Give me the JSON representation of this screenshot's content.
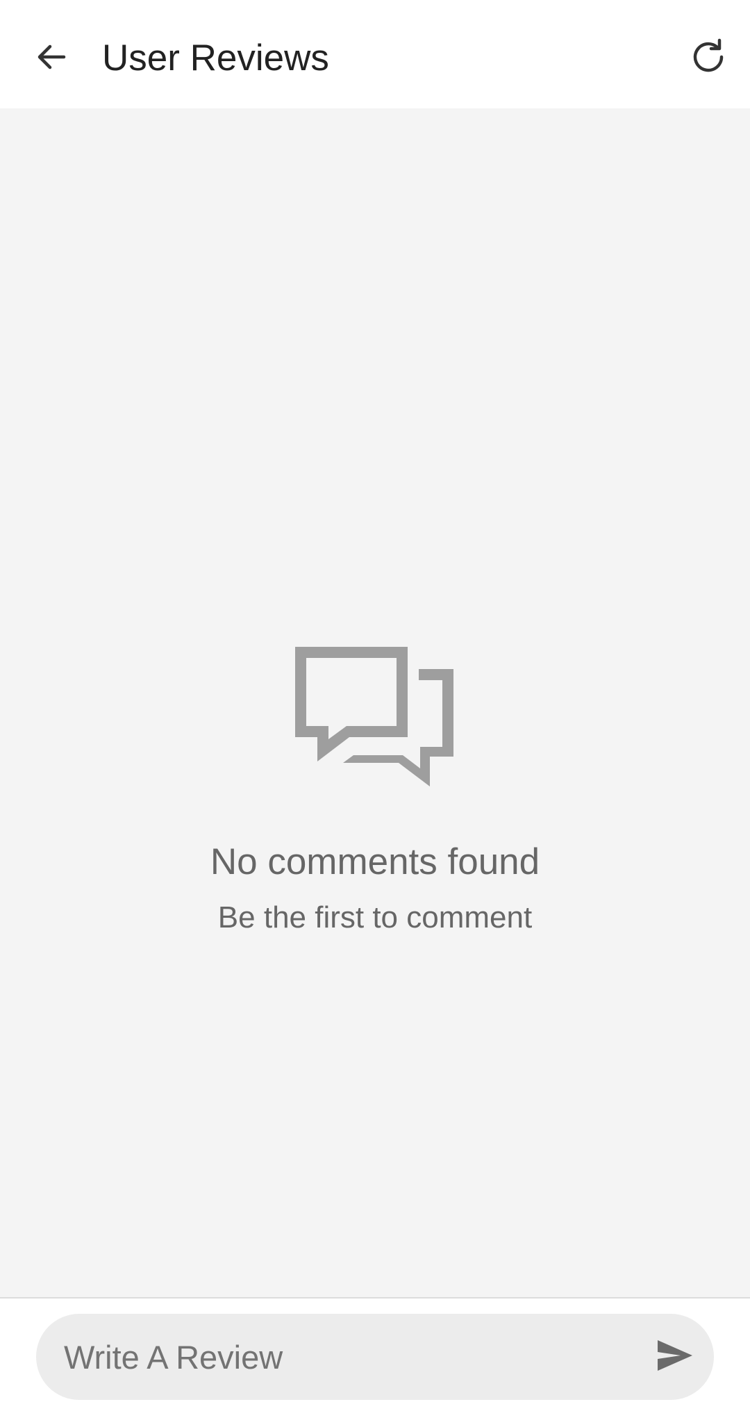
{
  "header": {
    "title": "User Reviews",
    "back_icon": "arrow-left-icon",
    "refresh_icon": "refresh-icon"
  },
  "empty_state": {
    "icon": "chat-bubbles-icon",
    "title": "No comments found",
    "subtitle": "Be the first to comment"
  },
  "composer": {
    "placeholder": "Write A Review",
    "send_icon": "send-icon"
  },
  "colors": {
    "header_bg": "#ffffff",
    "content_bg": "#f4f4f4",
    "icon_gray": "#9e9e9e",
    "text_gray": "#666666",
    "title_dark": "#222222",
    "input_bg": "#ececec"
  }
}
